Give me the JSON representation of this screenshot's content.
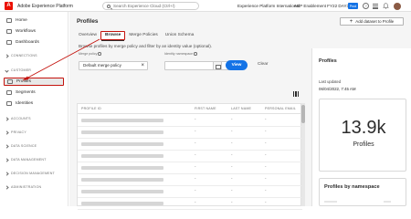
{
  "topbar": {
    "logo_letter": "A",
    "app_title": "Adobe Experience Platform",
    "search_placeholder": "Search Experience Cloud (Ctrl+/)",
    "org_name": "Experience Platform International",
    "sandbox_name": "AEP Enablement FY22 DAY3",
    "env_badge": "Prod"
  },
  "sidebar": {
    "items": [
      {
        "label": "Home"
      },
      {
        "label": "Workflows"
      },
      {
        "label": "Dashboards"
      },
      {
        "section": "CONNECTIONS"
      },
      {
        "section": "CUSTOMER"
      },
      {
        "label": "Profiles",
        "active": true
      },
      {
        "label": "Segments"
      },
      {
        "label": "Identities"
      },
      {
        "section": "ACCOUNTS"
      },
      {
        "section": "PRIVACY"
      },
      {
        "section": "DATA SCIENCE"
      },
      {
        "section": "DATA MANAGEMENT"
      },
      {
        "section": "DECISION MANAGEMENT"
      },
      {
        "section": "ADMINISTRATION"
      }
    ]
  },
  "main": {
    "title": "Profiles",
    "add_dataset_label": "Add dataset to Profile",
    "tabs": [
      {
        "label": "Overview"
      },
      {
        "label": "Browse",
        "selected": true
      },
      {
        "label": "Merge Policies"
      },
      {
        "label": "Union Schema"
      }
    ],
    "description": "Browse profiles by merge policy and filter by an identity value (optional).",
    "merge_policy_label": "Merge policy",
    "merge_policy_value": "Default merge policy",
    "identity_namespace_label": "Identity namespace",
    "view_label": "View",
    "clear_label": "Clear",
    "table": {
      "columns": [
        "PROFILE ID",
        "FIRST NAME",
        "LAST NAME",
        "PERSONAL EMAIL"
      ],
      "empty_cell": "-",
      "row_count": 8
    }
  },
  "rail": {
    "title": "Profiles",
    "last_updated_label": "Last updated",
    "last_updated_value": "06/04/2022, 7:45 AM",
    "metric_value": "13.9k",
    "metric_label": "Profiles",
    "namespace_card_title": "Profiles by namespace"
  },
  "colors": {
    "accent": "#1473e6",
    "annotation_red": "#c4120c",
    "brand_red": "#eb1000"
  }
}
